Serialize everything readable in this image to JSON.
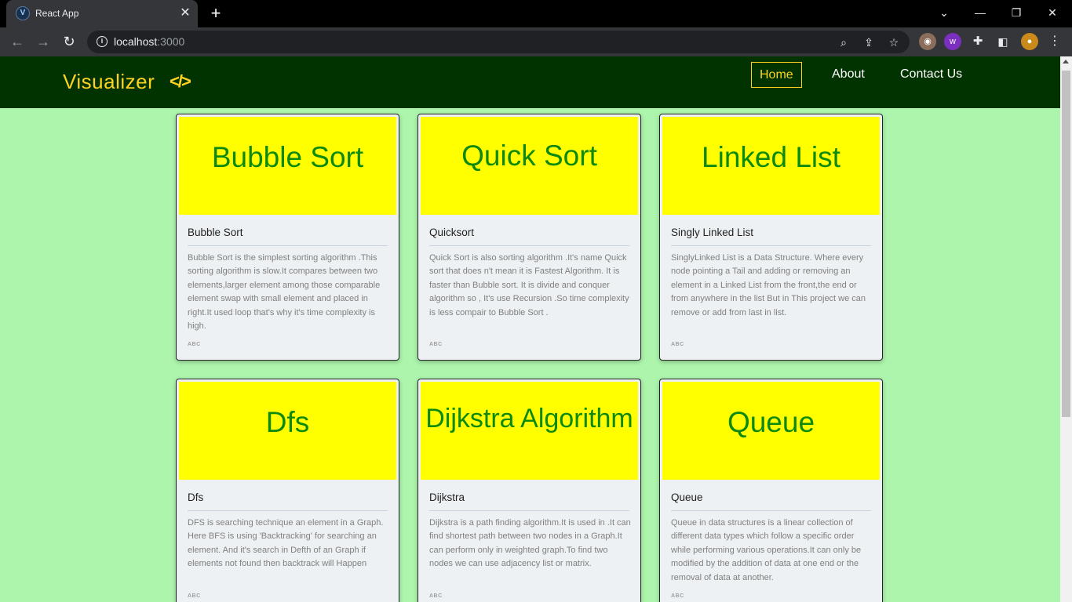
{
  "browser": {
    "tab_title": "React App",
    "favicon_letter": "V",
    "url_host": "localhost",
    "url_port": ":3000"
  },
  "site": {
    "brand": "Visualizer",
    "brand_icon": "</>",
    "nav": [
      "Home",
      "About",
      "Contact Us"
    ],
    "active_nav": "Home",
    "colors": {
      "nav_bg": "#003300",
      "page_bg": "#adf5ad",
      "accent": "#ffd21f",
      "banner": "#ffff00",
      "banner_text": "#0d8a0d"
    }
  },
  "cards": [
    {
      "banner": "Bubble Sort",
      "title": "Bubble Sort",
      "text": "Bubble Sort is the simplest sorting algorithm .This sorting algorithm is slow.It compares between two elements,larger element among those comparable element swap with small element and placed in right.It used loop that's why it's time complexity is high.",
      "tag": "ABC"
    },
    {
      "banner": "Quick Sort",
      "title": "Quicksort",
      "text": "Quick Sort is also sorting algorithm .It's name Quick sort that does n't mean it is Fastest Algorithm. It is faster than Bubble sort. It is divide and conquer algorithm so , It's use Recursion .So time complexity is less compair to Bubble Sort .",
      "tag": "ABC"
    },
    {
      "banner": "Linked List",
      "title": "Singly Linked List",
      "text": "SinglyLinked List is a Data Structure. Where every node pointing a Tail and adding or removing an element in a Linked List from the front,the end or from anywhere in the list But in This project we can remove or add from last in list.",
      "tag": "ABC"
    },
    {
      "banner": "Dfs",
      "title": "Dfs",
      "text": "DFS is searching technique an element in a Graph. Here BFS is using 'Backtracking' for searching an element. And it's search in Defth of an Graph if elements not found then backtrack will Happen",
      "tag": "ABC"
    },
    {
      "banner": "Dijkstra Algorithm",
      "title": "Dijkstra",
      "text": "Dijkstra is a path finding algorithm.It is used in .It can find shortest path between two nodes in a Graph.It can perform only in weighted graph.To find two nodes we can use adjacency list or matrix.",
      "tag": "ABC"
    },
    {
      "banner": "Queue",
      "title": "Queue",
      "text": "Queue in data structures is a linear collection of different data types which follow a specific order while performing various operations.It can only be modified by the addition of data at one end or the removal of data at another.",
      "tag": "ABC"
    }
  ]
}
